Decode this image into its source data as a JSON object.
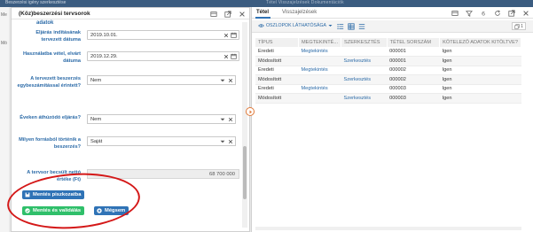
{
  "background": {
    "window_title": "Beszerzési igény szerkesztése",
    "menu": "Tétel   Visszajelzések   Dokumentációk",
    "side_label_1": "Me",
    "side_label_2": "Mó"
  },
  "left_panel": {
    "title": "(Köz)beszerzési tervsorok",
    "subtitle": "adatok",
    "fields": [
      {
        "label": "Eljárás indításának tervezett dátuma",
        "value": "2019.10.01."
      },
      {
        "label": "Használatba vétel, elvárt dátuma",
        "value": "2019.12.29."
      },
      {
        "label": "A tervezett beszerzés egybeszámítással érintett?",
        "value": "Nem"
      },
      {
        "label": "Éveken áthúzódó eljárás?",
        "value": "Nem"
      },
      {
        "label": "Milyen forrásból történik a beszerzés?",
        "value": "Saját"
      },
      {
        "label": "A tervsor becsült nettó értéke (Ft)",
        "value": "68 700 000"
      }
    ],
    "buttons": {
      "save_draft": "Mentés piszkozatba",
      "save_validate": "Mentés és validálás",
      "cancel": "Mégsem"
    }
  },
  "right_panel": {
    "tabs": [
      "Tétel",
      "Visszajelzések"
    ],
    "toolbar": {
      "columns_label": "OSZLOPOK LÁTHATÓSÁGA",
      "badge": "1"
    },
    "table": {
      "headers": [
        "TÍPUS",
        "MEGTEKINTÉ...",
        "SZERKESZTÉS",
        "TÉTEL SORSZÁM",
        "KÖTELEZŐ ADATOK KITÖLTVE?"
      ],
      "rows": [
        [
          "Eredeti",
          "Megtekintés",
          "",
          "000001",
          "Igen"
        ],
        [
          "Módosított",
          "",
          "Szerkesztés",
          "000001",
          "Igen"
        ],
        [
          "Eredeti",
          "Megtekintés",
          "",
          "000002",
          "Igen"
        ],
        [
          "Módosított",
          "",
          "Szerkesztés",
          "000002",
          "Igen"
        ],
        [
          "Eredeti",
          "Megtekintés",
          "",
          "000003",
          "Igen"
        ],
        [
          "Módosított",
          "",
          "Szerkesztés",
          "000003",
          "Igen"
        ]
      ]
    }
  },
  "colors": {
    "primary": "#2f73b6",
    "success": "#2fbf6a",
    "highlight": "#d41818",
    "label": "#2b6aa7"
  }
}
